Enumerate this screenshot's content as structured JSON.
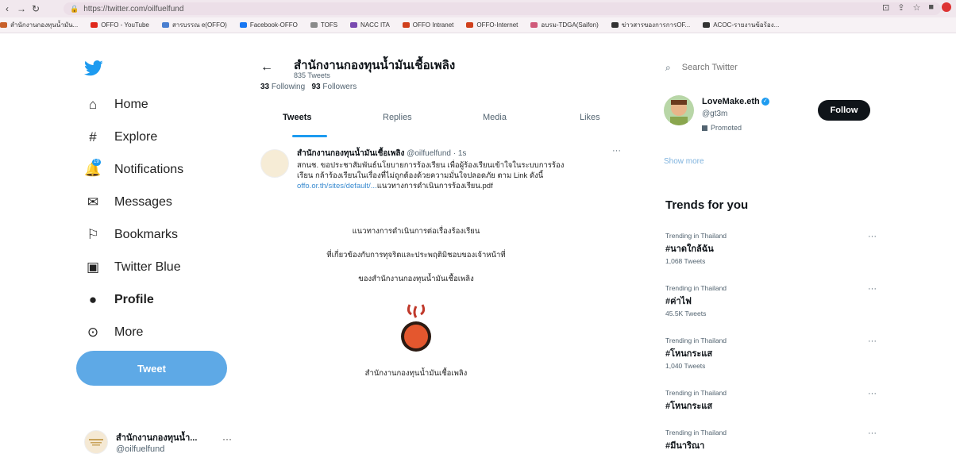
{
  "browser": {
    "url": "https://twitter.com/oilfuelfund",
    "bookmarks": [
      {
        "label": "สำนักงานกองทุนน้ำมัน...",
        "color": "#c8602a"
      },
      {
        "label": "OFFO - YouTube",
        "color": "#e0281c"
      },
      {
        "label": "สารบรรณ e(OFFO)",
        "color": "#4a7fd0"
      },
      {
        "label": "Facebook-OFFO",
        "color": "#1877f2"
      },
      {
        "label": "TOFS",
        "color": "#8a8a8a"
      },
      {
        "label": "NACC ITA",
        "color": "#7a4ab0"
      },
      {
        "label": "OFFO Intranet",
        "color": "#d0401c"
      },
      {
        "label": "OFFO-Internet",
        "color": "#d0401c"
      },
      {
        "label": "อบรม-TDGA(Saifon)",
        "color": "#d05a7a"
      },
      {
        "label": "ข่าวสารของการการOF...",
        "color": "#333333"
      },
      {
        "label": "ACOC-รายงานข้อร้อง...",
        "color": "#333333"
      }
    ]
  },
  "nav": {
    "items": [
      {
        "label": "Home",
        "icon": "home-icon"
      },
      {
        "label": "Explore",
        "icon": "hashtag-icon"
      },
      {
        "label": "Notifications",
        "icon": "bell-icon",
        "badge": "19"
      },
      {
        "label": "Messages",
        "icon": "envelope-icon"
      },
      {
        "label": "Bookmarks",
        "icon": "bookmark-icon"
      },
      {
        "label": "Twitter Blue",
        "icon": "twitter-blue-icon"
      },
      {
        "label": "Profile",
        "icon": "person-icon"
      },
      {
        "label": "More",
        "icon": "more-circle-icon"
      }
    ],
    "tweet_button": "Tweet"
  },
  "account": {
    "name": "สำนักงานกองทุนน้ำ...",
    "handle": "@oilfuelfund"
  },
  "profile": {
    "title": "สำนักงานกองทุนน้ำมันเชื้อเพลิง",
    "tweet_count": "835 Tweets",
    "following_count": "33",
    "following_label": "Following",
    "followers_count": "93",
    "followers_label": "Followers"
  },
  "tabs": [
    "Tweets",
    "Replies",
    "Media",
    "Likes"
  ],
  "tweet": {
    "author": "สำนักงานกองทุนน้ำมันเชื้อเพลิง",
    "handle_time": "@oilfuelfund · 1s",
    "text_line1": "สกนช. ขอประชาสัมพันธ์นโยบายการร้องเรียน เพื่อผู้ร้องเรียนเข้าใจในระบบการร้อง",
    "text_line2": "เรียน กล้าร้องเรียนในเรื่องที่ไม่ถูกต้องด้วยความมั่นใจปลอดภัย ตาม Link ดังนี้",
    "link": "offo.or.th/sites/default/...",
    "link_rest": "แนวทางการดำเนินการร้องเรียน.pdf",
    "media": {
      "line1": "แนวทางการดำเนินการต่อเรื่องร้องเรียน",
      "line2": "ที่เกี่ยวข้องกับการทุจริตและประพฤติมิชอบของเจ้าหน้าที่",
      "line3": "ของสำนักงานกองทุนน้ำมันเชื้อเพลิง",
      "caption": "สำนักงานกองทุนน้ำมันเชื้อเพลิง"
    }
  },
  "search": {
    "placeholder": "Search Twitter"
  },
  "promoted": {
    "name": "LoveMake.eth",
    "handle": "@gt3m",
    "promoted_label": "Promoted",
    "follow_label": "Follow"
  },
  "show_more": "Show more",
  "trends": {
    "heading": "Trends for you",
    "items": [
      {
        "context": "Trending in Thailand",
        "tag": "#นาดใกล้ฉัน",
        "count": "1,068 Tweets"
      },
      {
        "context": "Trending in Thailand",
        "tag": "#ค่าไฟ",
        "count": "45.5K Tweets"
      },
      {
        "context": "Trending in Thailand",
        "tag": "#โหนกระแส",
        "count": "1,040 Tweets"
      },
      {
        "context": "Trending in Thailand",
        "tag": "#โหนกระแส",
        "count": ""
      },
      {
        "context": "Trending in Thailand",
        "tag": "#มีนาริณา",
        "count": ""
      }
    ]
  }
}
